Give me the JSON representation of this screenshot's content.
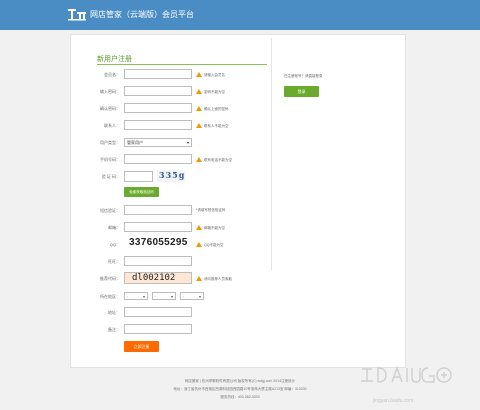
{
  "header": {
    "title": "网店管家（云端版）会员平台"
  },
  "form": {
    "title": "新用户注册",
    "fields": {
      "member_name": {
        "label": "会员名：",
        "hint": "请输入会员名"
      },
      "password": {
        "label": "输入密码：",
        "hint": "密码不能为空"
      },
      "confirm_password": {
        "label": "确认密码：",
        "hint": "确认上面的密码"
      },
      "contact": {
        "label": "联系人：",
        "hint": "联系人不能为空"
      },
      "user_type": {
        "label": "用户类型：",
        "selected": "管家用户"
      },
      "phone": {
        "label": "手机号码：",
        "hint": "联系电话不能为空"
      },
      "captcha": {
        "label": "验 证 码：",
        "image_text": "335g",
        "send_button": "免费获取验证码"
      },
      "sms_code": {
        "label": "短信验证：",
        "hint": "*请填写短信验证码"
      },
      "email": {
        "label": "邮箱：",
        "hint": "邮箱不能为空"
      },
      "qq": {
        "label": "QQ：",
        "value": "3376055295",
        "hint": "QQ不能为空"
      },
      "wangwang": {
        "label": "旺旺："
      },
      "recommend_code": {
        "label": "推荐代码：",
        "value": "dl002102",
        "hint": "请向推荐人员索取"
      },
      "region": {
        "label": "所在地区：",
        "province": "-",
        "city": "-",
        "district": "-"
      },
      "address": {
        "label": "地址："
      },
      "remark": {
        "label": "备注："
      }
    },
    "submit_label": "立即注册"
  },
  "side": {
    "text": "已注册账号？请直接登录",
    "login_label": "登录"
  },
  "footer": {
    "line1": "网店管家 | 杭州掌聊软件有限公司 版权所有(C) wdgj.com 2014注册统计",
    "line2": "地址：浙江省杭州市西湖区西湖科技园西园路10号浙商大厦主楼A213室 邮编：310030",
    "line3": "服务热线：400-082-0300"
  },
  "icons": {
    "logo": "wdgj-logo-icon",
    "warn": "warning-icon",
    "caret": "chevron-down-icon",
    "watermark": "baidu-jingyan-logo"
  },
  "colors": {
    "header_bg": "#4a8cc4",
    "accent_green": "#6aab2e",
    "submit_orange": "#ff6a00",
    "warn_orange": "#f39800"
  },
  "watermark_text": "jingyan.baidu.com"
}
